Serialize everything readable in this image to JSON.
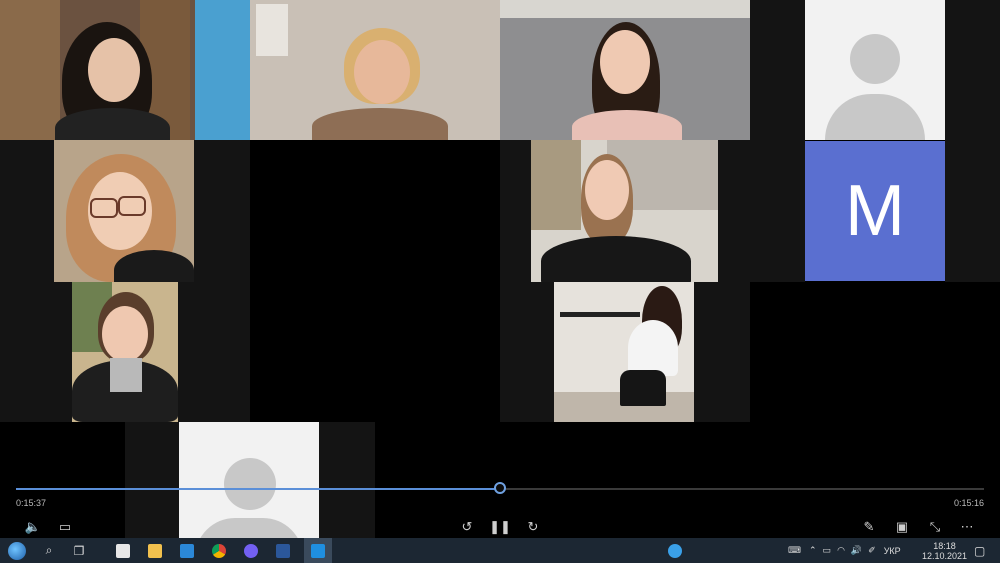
{
  "player": {
    "elapsed": "0:15:37",
    "remaining": "0:15:16",
    "progress": 0.5
  },
  "participants": {
    "avatar_letter": "M"
  },
  "taskbar": {
    "lang": "УКР",
    "time": "18:18",
    "date": "12.10.2021"
  },
  "colors": {
    "accent": "#5a6fd0",
    "timeline_fill": "#5b8fd8",
    "taskbar_bg": "#1c2733"
  }
}
